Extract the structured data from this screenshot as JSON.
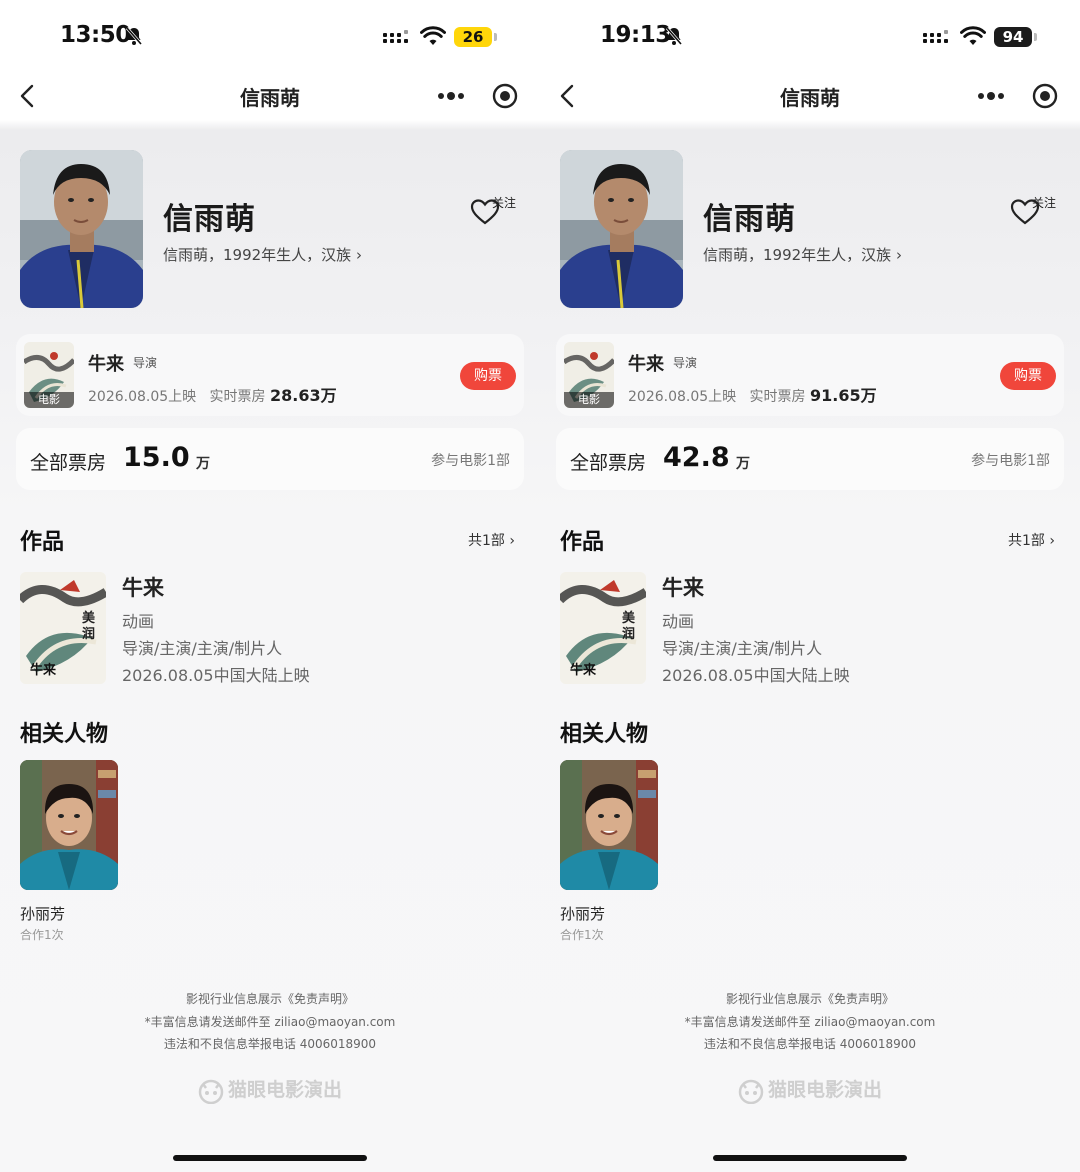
{
  "screens": [
    {
      "status": {
        "time": "13:50",
        "battery": "26"
      },
      "nav": {
        "title": "信雨萌"
      },
      "person": {
        "name": "信雨萌",
        "bio": "信雨萌，1992年生人，汉族",
        "follow_label": "关注"
      },
      "movie": {
        "title": "牛来",
        "role": "导演",
        "tag": "电影",
        "release": "2026.08.05上映",
        "box_label": "实时票房",
        "box_value": "28.63万",
        "buy_label": "购票"
      },
      "box_office": {
        "label": "全部票房",
        "value": "15.0",
        "unit": "万",
        "participation": "参与电影1部"
      },
      "works": {
        "heading": "作品",
        "count_label": "共1部",
        "title": "牛来",
        "genre": "动画",
        "roles": "导演/主演/主演/制片人",
        "release": "2026.08.05中国大陆上映"
      },
      "related": {
        "heading": "相关人物",
        "name": "孙丽芳",
        "collab": "合作1次"
      },
      "footer": {
        "line1": "影视行业信息展示《免责声明》",
        "line2": "*丰富信息请发送邮件至 ziliao@maoyan.com",
        "line3": "违法和不良信息举报电话 4006018900",
        "brand": "猫眼电影演出"
      }
    },
    {
      "status": {
        "time": "19:13",
        "battery": "94"
      },
      "nav": {
        "title": "信雨萌"
      },
      "person": {
        "name": "信雨萌",
        "bio": "信雨萌，1992年生人，汉族",
        "follow_label": "关注"
      },
      "movie": {
        "title": "牛来",
        "role": "导演",
        "tag": "电影",
        "release": "2026.08.05上映",
        "box_label": "实时票房",
        "box_value": "91.65万",
        "buy_label": "购票"
      },
      "box_office": {
        "label": "全部票房",
        "value": "42.8",
        "unit": "万",
        "participation": "参与电影1部"
      },
      "works": {
        "heading": "作品",
        "count_label": "共1部",
        "title": "牛来",
        "genre": "动画",
        "roles": "导演/主演/主演/制片人",
        "release": "2026.08.05中国大陆上映"
      },
      "related": {
        "heading": "相关人物",
        "name": "孙丽芳",
        "collab": "合作1次"
      },
      "footer": {
        "line1": "影视行业信息展示《免责声明》",
        "line2": "*丰富信息请发送邮件至 ziliao@maoyan.com",
        "line3": "违法和不良信息举报电话 4006018900",
        "brand": "猫眼电影演出"
      }
    }
  ],
  "colors": {
    "accent_red": "#f0463b",
    "battery_low": "#ffd60a",
    "battery_dark": "#1c1c1c"
  },
  "icons": [
    "back-chevron-icon",
    "more-dots-icon",
    "target-circle-icon",
    "heart-icon",
    "bell-muted-icon",
    "signal-icon",
    "wifi-icon",
    "battery-icon",
    "chevron-right-icon",
    "cat-logo-icon"
  ]
}
